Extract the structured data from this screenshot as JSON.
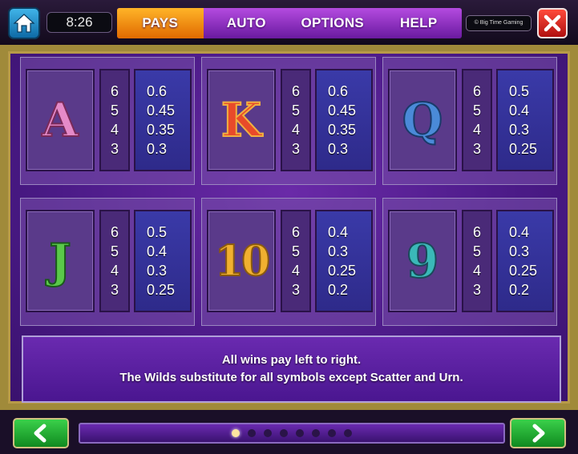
{
  "header": {
    "clock": "8:26",
    "tabs": [
      "PAYS",
      "AUTO",
      "OPTIONS",
      "HELP"
    ],
    "active_tab": "PAYS",
    "brand": "© Big Time Gaming"
  },
  "paytable": [
    {
      "symbol": "A",
      "counts": [
        "6",
        "5",
        "4",
        "3"
      ],
      "pays": [
        "0.6",
        "0.45",
        "0.35",
        "0.3"
      ]
    },
    {
      "symbol": "K",
      "counts": [
        "6",
        "5",
        "4",
        "3"
      ],
      "pays": [
        "0.6",
        "0.45",
        "0.35",
        "0.3"
      ]
    },
    {
      "symbol": "Q",
      "counts": [
        "6",
        "5",
        "4",
        "3"
      ],
      "pays": [
        "0.5",
        "0.4",
        "0.3",
        "0.25"
      ]
    },
    {
      "symbol": "J",
      "counts": [
        "6",
        "5",
        "4",
        "3"
      ],
      "pays": [
        "0.5",
        "0.4",
        "0.3",
        "0.25"
      ]
    },
    {
      "symbol": "10",
      "counts": [
        "6",
        "5",
        "4",
        "3"
      ],
      "pays": [
        "0.4",
        "0.3",
        "0.25",
        "0.2"
      ]
    },
    {
      "symbol": "9",
      "counts": [
        "6",
        "5",
        "4",
        "3"
      ],
      "pays": [
        "0.4",
        "0.3",
        "0.25",
        "0.2"
      ]
    }
  ],
  "info": {
    "line1": "All wins pay left to right.",
    "line2": "The Wilds substitute for all symbols except Scatter and Urn."
  },
  "pagination": {
    "total": 8,
    "current": 1
  },
  "icons": {
    "home": "home-icon",
    "close": "close-icon",
    "prev": "arrow-left-icon",
    "next": "arrow-right-icon"
  },
  "colors": {
    "active_tab": "#f08c10",
    "tab_bar": "#9a36d0",
    "panel": "#4a1a86",
    "nav_button": "#22b034",
    "close_button": "#e02a20"
  }
}
